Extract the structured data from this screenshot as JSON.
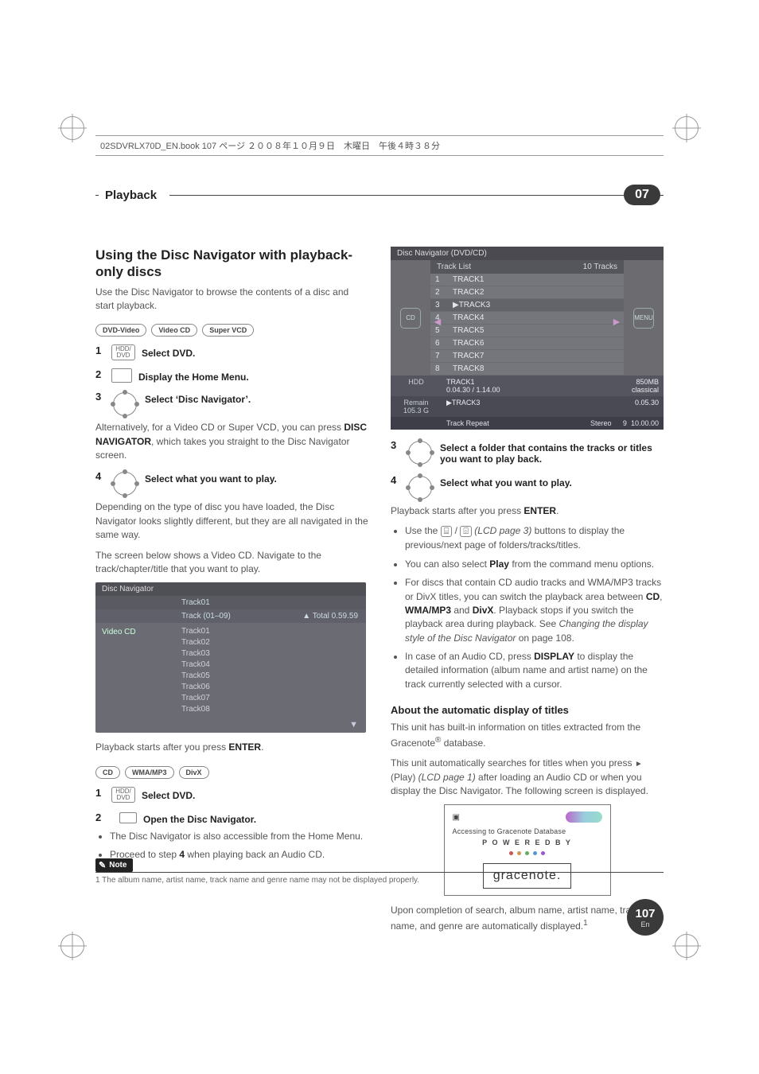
{
  "book_header": "02SDVRLX70D_EN.book  107 ページ  ２００８年１０月９日　木曜日　午後４時３８分",
  "tab": {
    "title": "Playback",
    "number": "07"
  },
  "col1": {
    "h2": "Using the Disc Navigator with playback-only discs",
    "p1": "Use the Disc Navigator to browse the contents of a disc and start playback.",
    "badges1": [
      "DVD-Video",
      "Video CD",
      "Super VCD"
    ],
    "step1": {
      "num": "1",
      "icon": "HDD/\nDVD",
      "text": "Select DVD."
    },
    "step2": {
      "num": "2",
      "text": "Display the Home Menu."
    },
    "step3": {
      "num": "3",
      "text": "Select ‘Disc Navigator’."
    },
    "p2a": "Alternatively, for a Video CD or Super VCD, you can press ",
    "p2b": "DISC NAVIGATOR",
    "p2c": ", which takes you straight to the Disc Navigator screen.",
    "step4": {
      "num": "4",
      "text": "Select what you want to play."
    },
    "p3": "Depending on the type of disc you have loaded, the Disc Navigator looks slightly different, but they are all navigated in the same way.",
    "p4": "The screen below shows a Video CD. Navigate to the track/chapter/title that you want to play.",
    "vcd": {
      "title": "Disc Navigator",
      "col_mid": "Track01",
      "trackhdr": "Track (01–09)",
      "total": "Total 0.59.59",
      "left": "Video CD",
      "tracks": [
        "Track01",
        "Track02",
        "Track03",
        "Track04",
        "Track05",
        "Track06",
        "Track07",
        "Track08"
      ]
    },
    "p5a": "Playback starts after you press ",
    "p5b": "ENTER",
    "p5c": ".",
    "badges2": [
      "CD",
      "WMA/MP3",
      "DivX"
    ],
    "b_step1": {
      "num": "1",
      "icon": "HDD/\nDVD",
      "text": "Select DVD."
    },
    "b_step2": {
      "num": "2",
      "text": "Open the Disc Navigator."
    },
    "b_bul1": "The Disc Navigator is also accessible from the Home Menu.",
    "b_bul2a": "Proceed to step ",
    "b_bul2b": "4",
    "b_bul2c": " when playing back an Audio CD."
  },
  "col2": {
    "dvd": {
      "title": "Disc Navigator (DVD/CD)",
      "lhead": "Track List",
      "rhead": "10 Tracks",
      "menu": "MENU",
      "rows": [
        {
          "n": "1",
          "t": "TRACK1"
        },
        {
          "n": "2",
          "t": "TRACK2"
        },
        {
          "n": "3",
          "t": "▶TRACK3"
        },
        {
          "n": "4",
          "t": "TRACK4"
        },
        {
          "n": "5",
          "t": "TRACK5"
        },
        {
          "n": "6",
          "t": "TRACK6"
        },
        {
          "n": "7",
          "t": "TRACK7"
        },
        {
          "n": "8",
          "t": "TRACK8"
        }
      ],
      "info1_l": "HDD",
      "info1_m1": "TRACK1",
      "info1_m2": "0.04.30 / 1.14.00",
      "info1_r1": "850MB",
      "info1_r2": "classical",
      "info2_l": "Remain\n105.3 G",
      "info2_m": "▶TRACK3",
      "info2_r": "0.05.30",
      "bar": [
        "",
        "Track Repeat",
        "Stereo",
        "9",
        "10.00.00"
      ]
    },
    "step3": {
      "num": "3",
      "text": "Select a folder that contains the tracks or titles you want to play back."
    },
    "step4": {
      "num": "4",
      "text": "Select what you want to play."
    },
    "p1a": "Playback starts after you press ",
    "p1b": "ENTER",
    "p1c": ".",
    "bul1a": "Use the ",
    "bul1b": " / ",
    "bul1c": " (LCD page 3)",
    "bul1d": " buttons to display the previous/next page of folders/tracks/titles.",
    "bul2a": "You can also select ",
    "bul2b": "Play",
    "bul2c": " from the command menu options.",
    "bul3a": "For discs that contain CD audio tracks and WMA/MP3 tracks or DivX titles, you can switch the playback area between ",
    "bul3b": "CD",
    "bul3c": ", ",
    "bul3d": "WMA/MP3",
    "bul3e": " and ",
    "bul3f": "DivX",
    "bul3g": ". Playback stops if you switch the playback area during playback. See ",
    "bul3h": "Changing the display style of the Disc Navigator",
    "bul3i": " on page 108.",
    "bul4a": "In case of an Audio CD, press ",
    "bul4b": "DISPLAY",
    "bul4c": " to display the detailed information (album name and artist name) on the track currently selected with a cursor.",
    "h3": "About the automatic display of titles",
    "p2a": "This unit has built-in information on titles extracted from the Gracenote",
    "p2b": "®",
    "p2c": " database.",
    "p3a": "This unit automatically searches for titles when you press ",
    "p3b": " (Play) ",
    "p3c": "(LCD page 1)",
    "p3d": " after loading an Audio CD or when you display the Disc Navigator. The following screen is displayed.",
    "grace": {
      "access": "Accessing to Gracenote Database",
      "powered": "P O W E R E D   B Y",
      "logo": "gracenote."
    },
    "p4": "Upon completion of search, album name, artist name, track name, and genre are automatically displayed.",
    "sup": "1"
  },
  "note_label": "Note",
  "footnote": "1 The album name, artist name, track name and genre name may not be displayed properly.",
  "page": {
    "num": "107",
    "lang": "En"
  }
}
